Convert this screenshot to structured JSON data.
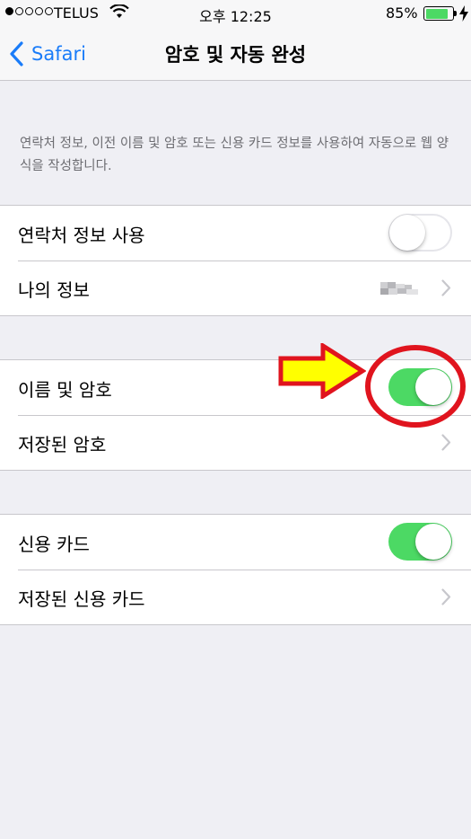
{
  "status_bar": {
    "carrier": "TELUS",
    "time": "오후 12:25",
    "battery_percent": "85%",
    "battery_level": 0.85,
    "signal_bars_filled": 1,
    "signal_bars_total": 5
  },
  "nav": {
    "back_label": "Safari",
    "title": "암호 및 자동 완성"
  },
  "description": "연락처 정보, 이전 이름 및 암호 또는 신용 카드 정보를 사용하여 자동으로 웹 양식을 작성합니다.",
  "groups": [
    {
      "rows": [
        {
          "label": "연락처 정보 사용",
          "toggle": "off"
        },
        {
          "label": "나의 정보",
          "detail": "(blurred)",
          "chevron": true
        }
      ]
    },
    {
      "rows": [
        {
          "label": "이름 및 암호",
          "toggle": "on"
        },
        {
          "label": "저장된 암호",
          "chevron": true
        }
      ]
    },
    {
      "rows": [
        {
          "label": "신용 카드",
          "toggle": "on"
        },
        {
          "label": "저장된 신용 카드",
          "chevron": true
        }
      ]
    }
  ],
  "annotation": {
    "arrow_color": "#ffff00",
    "outline_color": "#e0141e"
  },
  "colors": {
    "accent": "#1a7cf9",
    "toggle_on": "#4cd964",
    "background": "#efeff4"
  }
}
